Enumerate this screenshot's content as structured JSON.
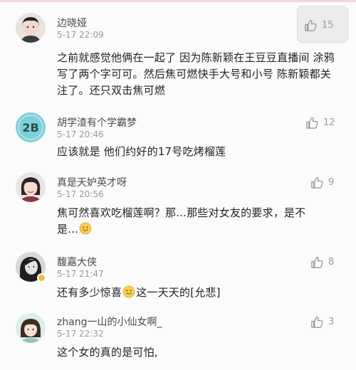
{
  "comments": [
    {
      "name": "边晓娅",
      "time": "5-17 22:09",
      "text": "之前就感觉他俩在一起了 因为陈新颖在王豆豆直播间 涂鸦写了两个字可可。然后焦可燃快手大号和小号 陈新颖都关注了。还只双击焦可燃",
      "likes": "15"
    },
    {
      "name": "胡学渣有个学霸梦",
      "time": "5-17 20:46",
      "text": "应该就是 他们约好的17号吃烤榴莲",
      "likes": "12",
      "avatar_text": "2B"
    },
    {
      "name": "真是天妒英才呀",
      "time": "5-17 20:56",
      "text_a": "焦可然喜欢吃榴莲啊？那...那些对女友的要求，是不",
      "text_b": "是...",
      "likes": "9"
    },
    {
      "name": "馥嘉大侠",
      "time": "5-17 21:47",
      "text_a": "还有多少惊喜",
      "text_b": "这一天天的[允悲]",
      "likes": "8"
    },
    {
      "name": "zhang一山的小仙女啊_",
      "time": "5-17 22:32",
      "text": "这个女的真的是可怕,",
      "likes": "3"
    }
  ],
  "colors": {
    "name": "#4a4a4a",
    "time": "#9a9a9a",
    "text": "#222222",
    "badge": "#f3b93a",
    "avatar_2b": "#7ed0d8"
  },
  "icons": {
    "like": "thumbs-up-icon",
    "smile": "smile-emoji-icon"
  }
}
